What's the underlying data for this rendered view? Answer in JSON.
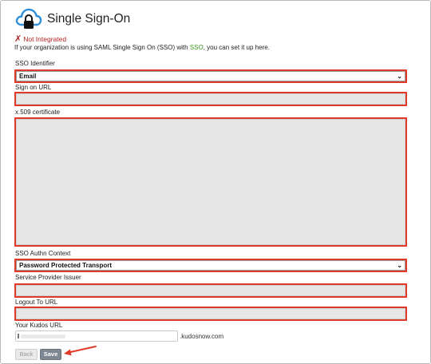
{
  "header": {
    "title": "Single Sign-On",
    "logo_icon": "cloud-lock-icon"
  },
  "status": {
    "icon": "✗",
    "text": "Not Integrated"
  },
  "intro": {
    "before": "If your organization is using SAML Single Sign On (SSO) with ",
    "link": "SSO",
    "after": ", you can set it up here."
  },
  "form": {
    "sso_identifier_label": "SSO Identifier",
    "sso_identifier_value": "Email",
    "sign_on_url_label": "Sign on URL",
    "certificate_label": "x.509 certificate",
    "authn_context_label": "SSO Authn Context",
    "authn_context_value": "Password Protected Transport",
    "issuer_label": "Service Provider Issuer",
    "logout_url_label": "Logout To URL",
    "kudos_url_label": "Your Kudos URL",
    "kudos_url_suffix": ".kudosnow.com"
  },
  "buttons": {
    "back": "Back",
    "save": "Save"
  },
  "colors": {
    "highlight": "#e03a2a",
    "error": "#b22222",
    "link": "#3c9a1e",
    "save_button": "#7d8893"
  }
}
